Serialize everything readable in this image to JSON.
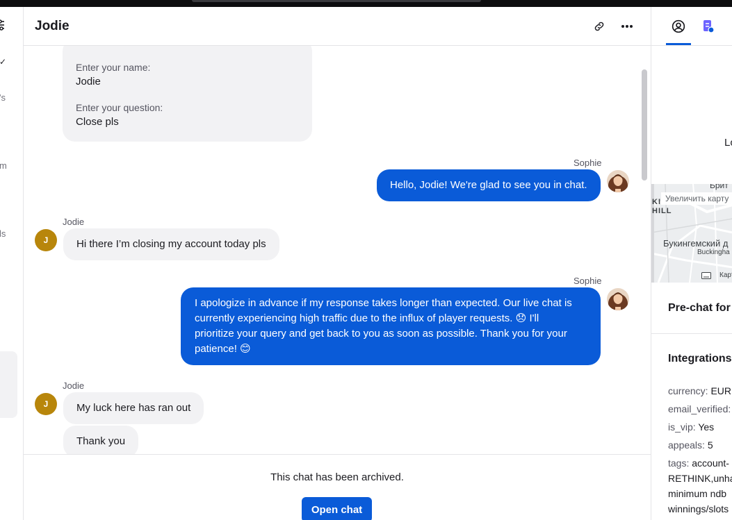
{
  "left_strip": {
    "fragments": [
      "✓",
      "'s",
      "m",
      "ls"
    ]
  },
  "chat": {
    "title": "Jodie",
    "prechat": {
      "name_label": "Enter your name:",
      "name_value": "Jodie",
      "question_label": "Enter your question:",
      "question_value": "Close pls"
    },
    "messages": [
      {
        "sender": "Sophie",
        "direction": "out",
        "text": "Hello, Jodie! We're glad to see you in chat."
      },
      {
        "sender": "Jodie",
        "direction": "in",
        "avatar": "J",
        "text": "Hi there I’m closing my account today pls"
      },
      {
        "sender": "Sophie",
        "direction": "out",
        "lines": [
          "I apologize in advance if my response takes longer than expected. Our live chat is",
          "currently experiencing high traffic due to the influx of player requests. 😞 I'll",
          "prioritize your query and get back to you as soon as possible. Thank you for your",
          "patience! 😊"
        ]
      },
      {
        "sender": "Jodie",
        "direction": "in",
        "avatar": "J",
        "texts": [
          "My luck here has ran out",
          "Thank you"
        ]
      }
    ],
    "archived_text": "This chat has been archived.",
    "open_chat_label": "Open chat"
  },
  "right_panel": {
    "location_fragment": "Lo",
    "map": {
      "zoom_label": "Увеличить карту",
      "labels": [
        "Брит",
        "KI",
        "HILL",
        "Букингемский д",
        "Buckingha",
        "Карт"
      ]
    },
    "prechat_title": "Pre-chat for",
    "integrations_title": "Integrations",
    "fields": [
      {
        "key": "currency:",
        "value": "EUR"
      },
      {
        "key": "email_verified:",
        "value": ""
      },
      {
        "key": "is_vip:",
        "value": "Yes"
      },
      {
        "key": "appeals:",
        "value": "5"
      },
      {
        "key": "tags:",
        "value": "account-"
      }
    ],
    "tags_continued": [
      "RETHINK,unha",
      "minimum ndb",
      "winnings/slots"
    ]
  },
  "colors": {
    "accent": "#0a5bd8",
    "bubble_in": "#f2f2f4",
    "avatar_j": "#b8860b"
  }
}
